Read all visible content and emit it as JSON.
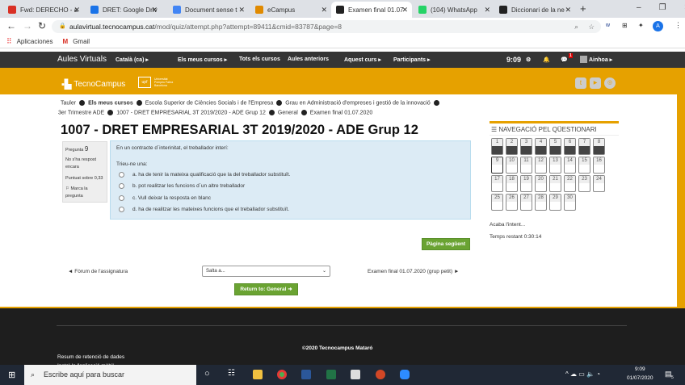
{
  "browser": {
    "tabs": [
      {
        "label": "Fwd: DERECHO - a",
        "icon": "gmail-icon",
        "color": "#d93025"
      },
      {
        "label": "DRET: Google Driv",
        "icon": "google-drive-icon",
        "color": "#1a73e8"
      },
      {
        "label": "Document sense t",
        "icon": "google-docs-icon",
        "color": "#4285f4"
      },
      {
        "label": "eCampus",
        "icon": "ecampus-icon",
        "color": "#e08a00"
      },
      {
        "label": "Examen final 01.07",
        "icon": "tecnocampus-icon",
        "color": "#222"
      },
      {
        "label": "(104) WhatsApp",
        "icon": "whatsapp-icon",
        "color": "#25d366"
      },
      {
        "label": "Diccionari de la ne",
        "icon": "dictionary-icon",
        "color": "#222"
      }
    ],
    "url_domain": "aulavirtual.tecnocampus.cat",
    "url_path": "/mod/quiz/attempt.php?attempt=89411&cmid=83787&page=8",
    "profile_initial": "A",
    "bookmarks": [
      "Aplicaciones",
      "Gmail"
    ]
  },
  "navbar": {
    "brand": "Aules Virtuals",
    "items": [
      "Català (ca) ▸",
      "Els meus cursos ▸",
      "Tots els cursos",
      "Aules anteriors",
      "Aquest curs ▸",
      "Participants ▸"
    ],
    "time": "9:09",
    "notif_count": "1",
    "user": "Ainhoa ▸"
  },
  "header": {
    "logo": "TecnoCampus",
    "partner": "Universitat Pompeu Fabra Barcelona"
  },
  "breadcrumb": {
    "line1": [
      "Tauler",
      "Els meus cursos",
      "Escola Superior de Ciències Socials i de l'Empresa",
      "Grau en Administració d'empreses i gestió de la innovació"
    ],
    "line2": [
      "3er Trimestre ADE",
      "1007 - DRET EMPRESARIAL 3T 2019/2020 - ADE Grup 12",
      "General",
      "Examen final 01.07.2020"
    ]
  },
  "page_title": "1007 - DRET EMPRESARIAL 3T 2019/2020 - ADE Grup 12",
  "question": {
    "label": "Pregunta",
    "number": "9",
    "status": "No s'ha respost encara",
    "score": "Puntuat sobre 0,33",
    "flag": "Marca la pregunta",
    "text": "En un contracte d´interinitat, el treballador interí:",
    "prompt": "Trieu-ne una:",
    "options": [
      "a. ha de tenir la mateixa qualificació que la del treballador substituït.",
      "b. pot realitzar les funcions d´un altre treballador",
      "c. Vull deixar la resposta en blanc",
      "d. ha de realitzar les mateixes funcions que el treballador substituït."
    ]
  },
  "next_button": "Pàgina següent",
  "quiz_nav": {
    "title": "NAVEGACIÓ PEL QÜESTIONARI",
    "answered": [
      1,
      2,
      3,
      4,
      5,
      6,
      7,
      8
    ],
    "current": 9,
    "total": 30,
    "finish": "Acaba l'intent...",
    "time_left": "Temps restant 0:30:14"
  },
  "activity_nav": {
    "prev": "◄ Fòrum de l'assignatura",
    "jump": "Salta a...",
    "next": "Examen final 01.07.2020 (grup petit) ►",
    "return": "Return to: General"
  },
  "footer": {
    "copyright": "©2020 Tecnocampus Mataró",
    "links": [
      "Resum de retenció de dades",
      "Instal·la l'aplicació mòbil"
    ]
  },
  "taskbar": {
    "search_placeholder": "Escribe aquí para buscar",
    "time": "9:09",
    "date": "01/07/2020",
    "notifications": "5"
  }
}
